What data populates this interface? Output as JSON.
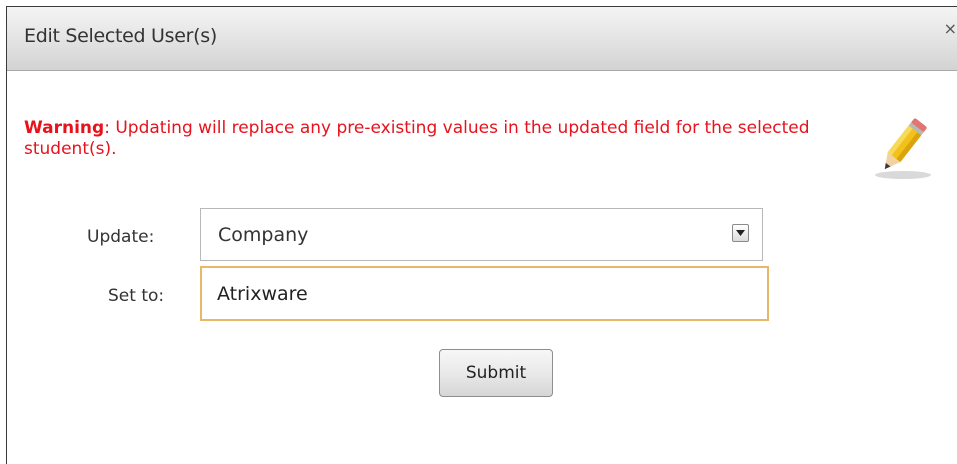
{
  "dialog": {
    "title": "Edit Selected User(s)",
    "close_glyph": "×"
  },
  "warning": {
    "label": "Warning",
    "message": ": Updating will replace any pre-existing values in the updated field for the selected student(s).",
    "color": "#e8121c",
    "icon": "pencil-icon"
  },
  "form": {
    "update_label": "Update:",
    "update_value": "Company",
    "set_to_label": "Set to:",
    "set_to_value": "Atrixware",
    "submit_label": "Submit"
  }
}
